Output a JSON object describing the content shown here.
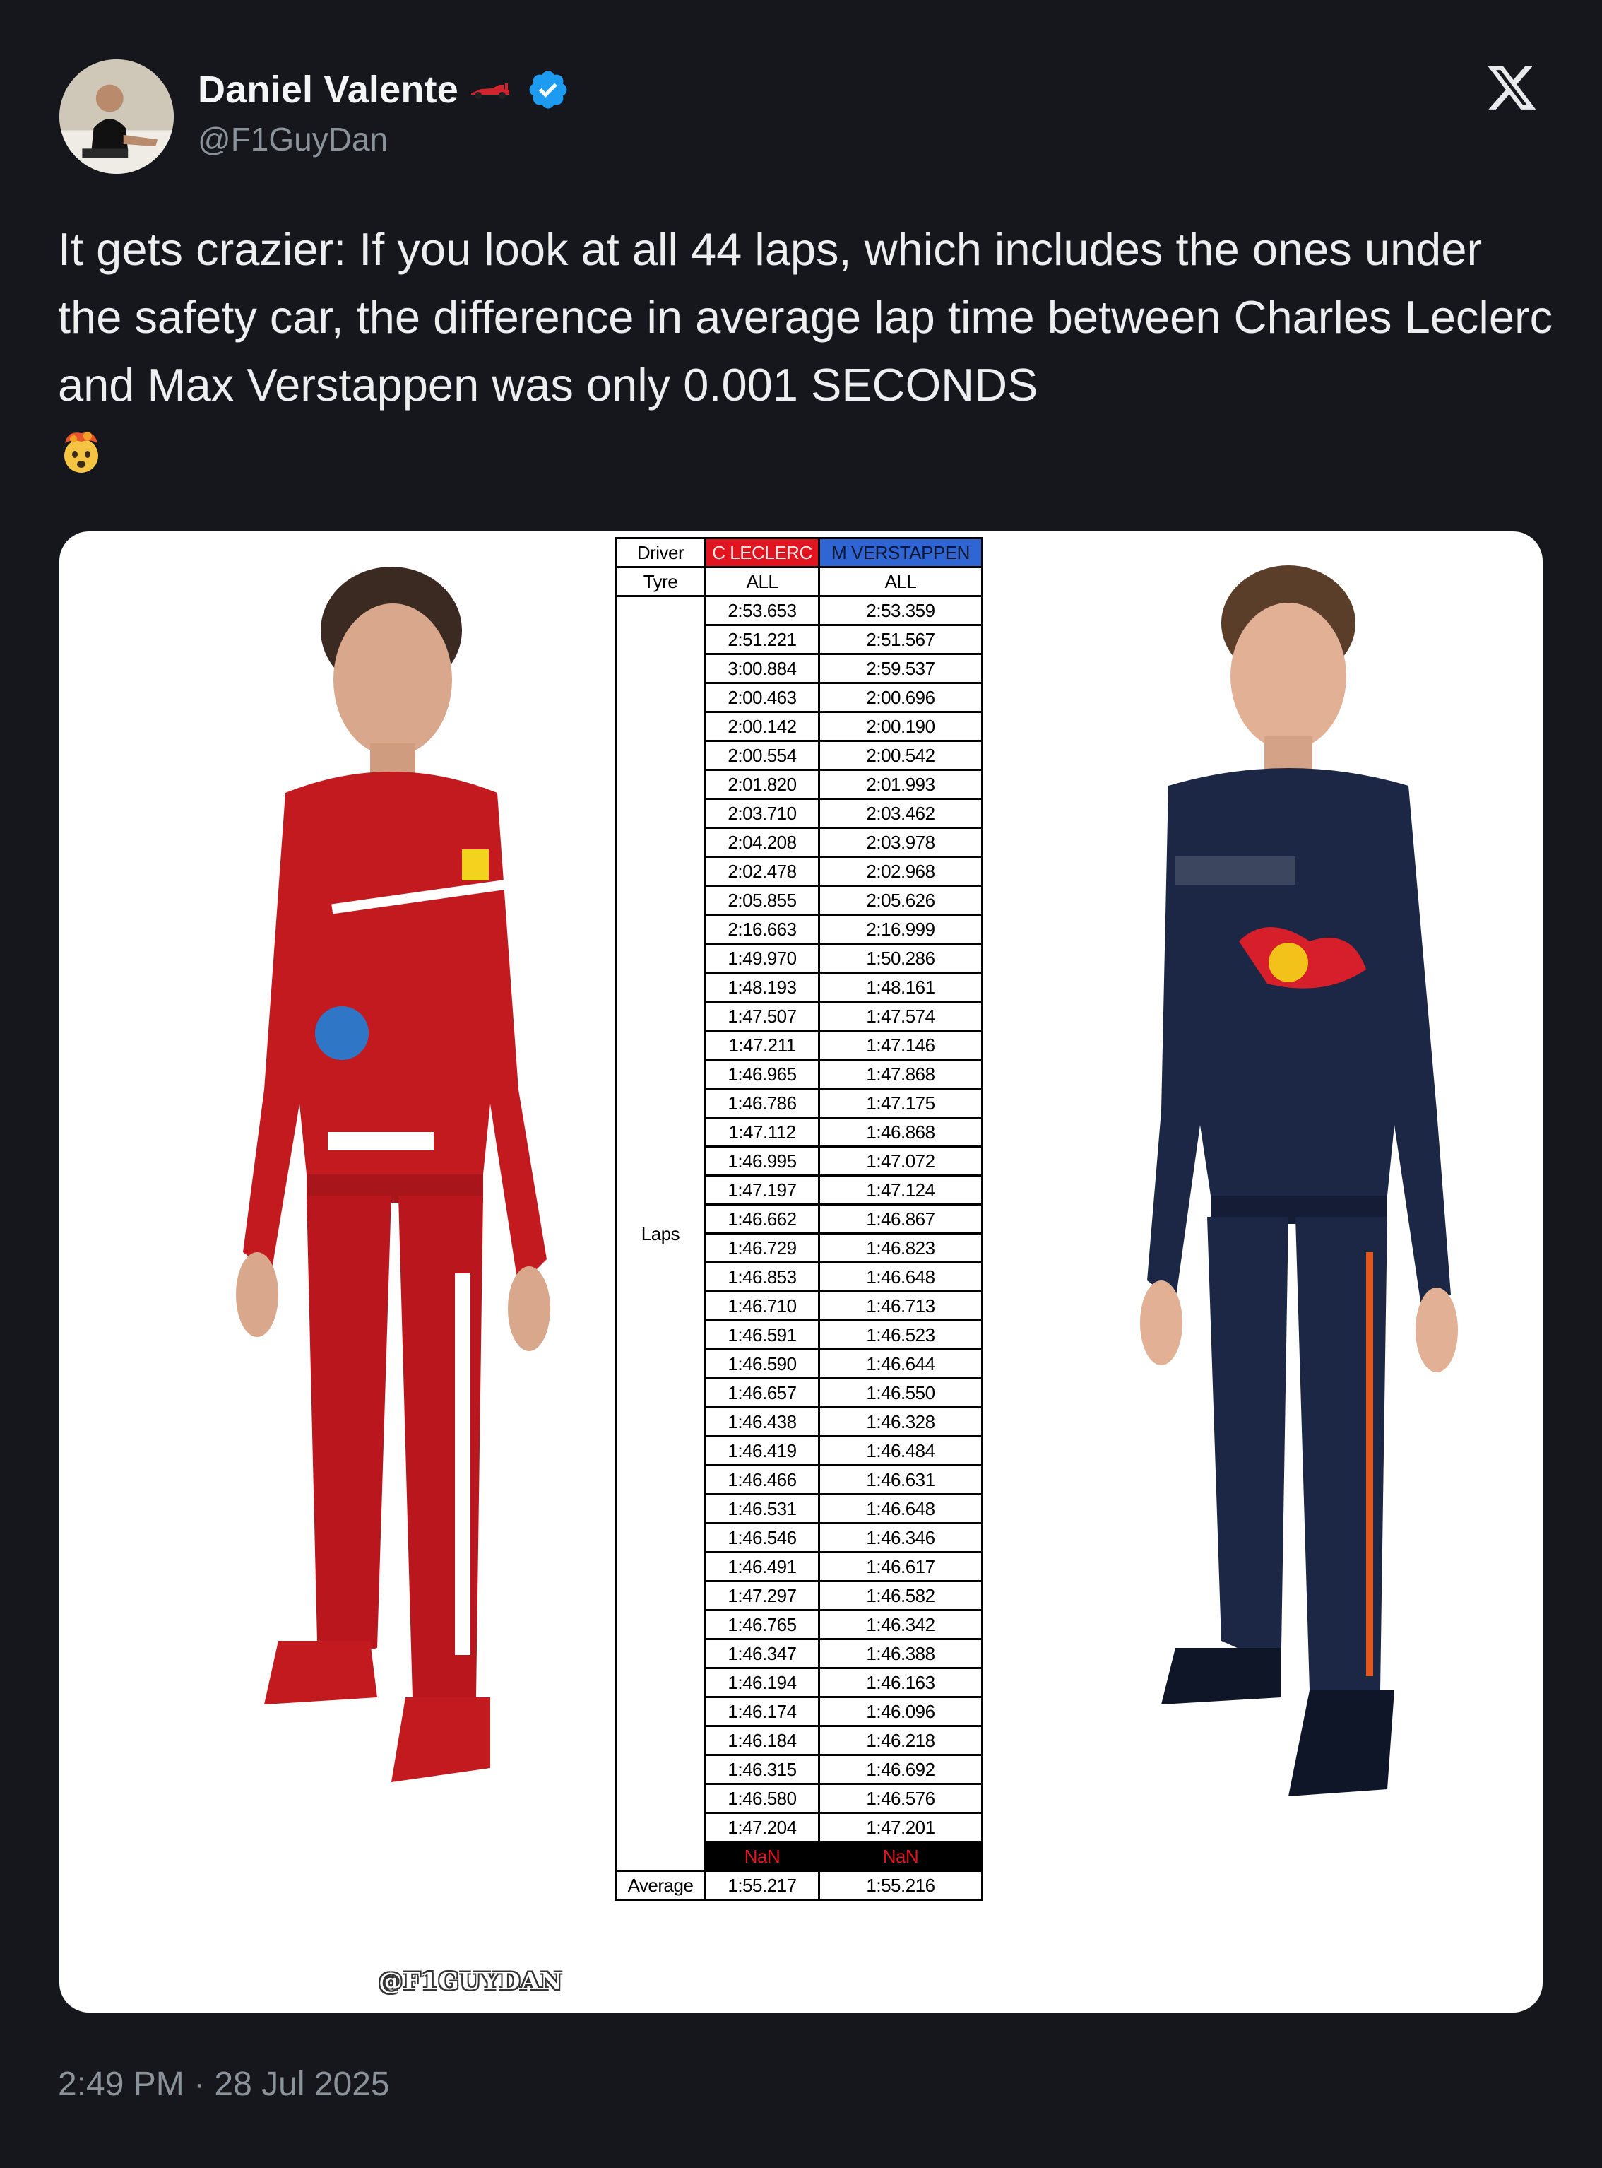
{
  "author": {
    "name": "Daniel Valente",
    "handle": "@F1GuyDan",
    "name_icon": "f1-car-icon",
    "verified_icon": "verified-badge-icon",
    "verified_color": "#1d9bf0"
  },
  "platform_logo": "x-logo",
  "tweet": {
    "text": "It gets crazier: If you look at all 44 laps, which includes the ones under the safety car, the difference in average lap time between Charles Leclerc and Max Verstappen was only 0.001 SECONDS",
    "emoji": "exploding-head-icon"
  },
  "media": {
    "watermark": "@F1GUYDAN",
    "table": {
      "driver_label": "Driver",
      "tyre_label": "Tyre",
      "laps_label": "Laps",
      "average_label": "Average",
      "drivers": [
        "C LECLERC",
        "M VERSTAPPEN"
      ],
      "driver_colors": [
        "#e0151f",
        "#2f66d4"
      ],
      "tyres": [
        "ALL",
        "ALL"
      ],
      "laps": [
        [
          "2:53.653",
          "2:53.359"
        ],
        [
          "2:51.221",
          "2:51.567"
        ],
        [
          "3:00.884",
          "2:59.537"
        ],
        [
          "2:00.463",
          "2:00.696"
        ],
        [
          "2:00.142",
          "2:00.190"
        ],
        [
          "2:00.554",
          "2:00.542"
        ],
        [
          "2:01.820",
          "2:01.993"
        ],
        [
          "2:03.710",
          "2:03.462"
        ],
        [
          "2:04.208",
          "2:03.978"
        ],
        [
          "2:02.478",
          "2:02.968"
        ],
        [
          "2:05.855",
          "2:05.626"
        ],
        [
          "2:16.663",
          "2:16.999"
        ],
        [
          "1:49.970",
          "1:50.286"
        ],
        [
          "1:48.193",
          "1:48.161"
        ],
        [
          "1:47.507",
          "1:47.574"
        ],
        [
          "1:47.211",
          "1:47.146"
        ],
        [
          "1:46.965",
          "1:47.868"
        ],
        [
          "1:46.786",
          "1:47.175"
        ],
        [
          "1:47.112",
          "1:46.868"
        ],
        [
          "1:46.995",
          "1:47.072"
        ],
        [
          "1:47.197",
          "1:47.124"
        ],
        [
          "1:46.662",
          "1:46.867"
        ],
        [
          "1:46.729",
          "1:46.823"
        ],
        [
          "1:46.853",
          "1:46.648"
        ],
        [
          "1:46.710",
          "1:46.713"
        ],
        [
          "1:46.591",
          "1:46.523"
        ],
        [
          "1:46.590",
          "1:46.644"
        ],
        [
          "1:46.657",
          "1:46.550"
        ],
        [
          "1:46.438",
          "1:46.328"
        ],
        [
          "1:46.419",
          "1:46.484"
        ],
        [
          "1:46.466",
          "1:46.631"
        ],
        [
          "1:46.531",
          "1:46.648"
        ],
        [
          "1:46.546",
          "1:46.346"
        ],
        [
          "1:46.491",
          "1:46.617"
        ],
        [
          "1:47.297",
          "1:46.582"
        ],
        [
          "1:46.765",
          "1:46.342"
        ],
        [
          "1:46.347",
          "1:46.388"
        ],
        [
          "1:46.194",
          "1:46.163"
        ],
        [
          "1:46.174",
          "1:46.096"
        ],
        [
          "1:46.184",
          "1:46.218"
        ],
        [
          "1:46.315",
          "1:46.692"
        ],
        [
          "1:46.580",
          "1:46.576"
        ],
        [
          "1:47.204",
          "1:47.201"
        ],
        [
          "NaN",
          "NaN"
        ]
      ],
      "averages": [
        "1:55.217",
        "1:55.216"
      ]
    }
  },
  "timestamp": "2:49 PM · 28 Jul 2025"
}
